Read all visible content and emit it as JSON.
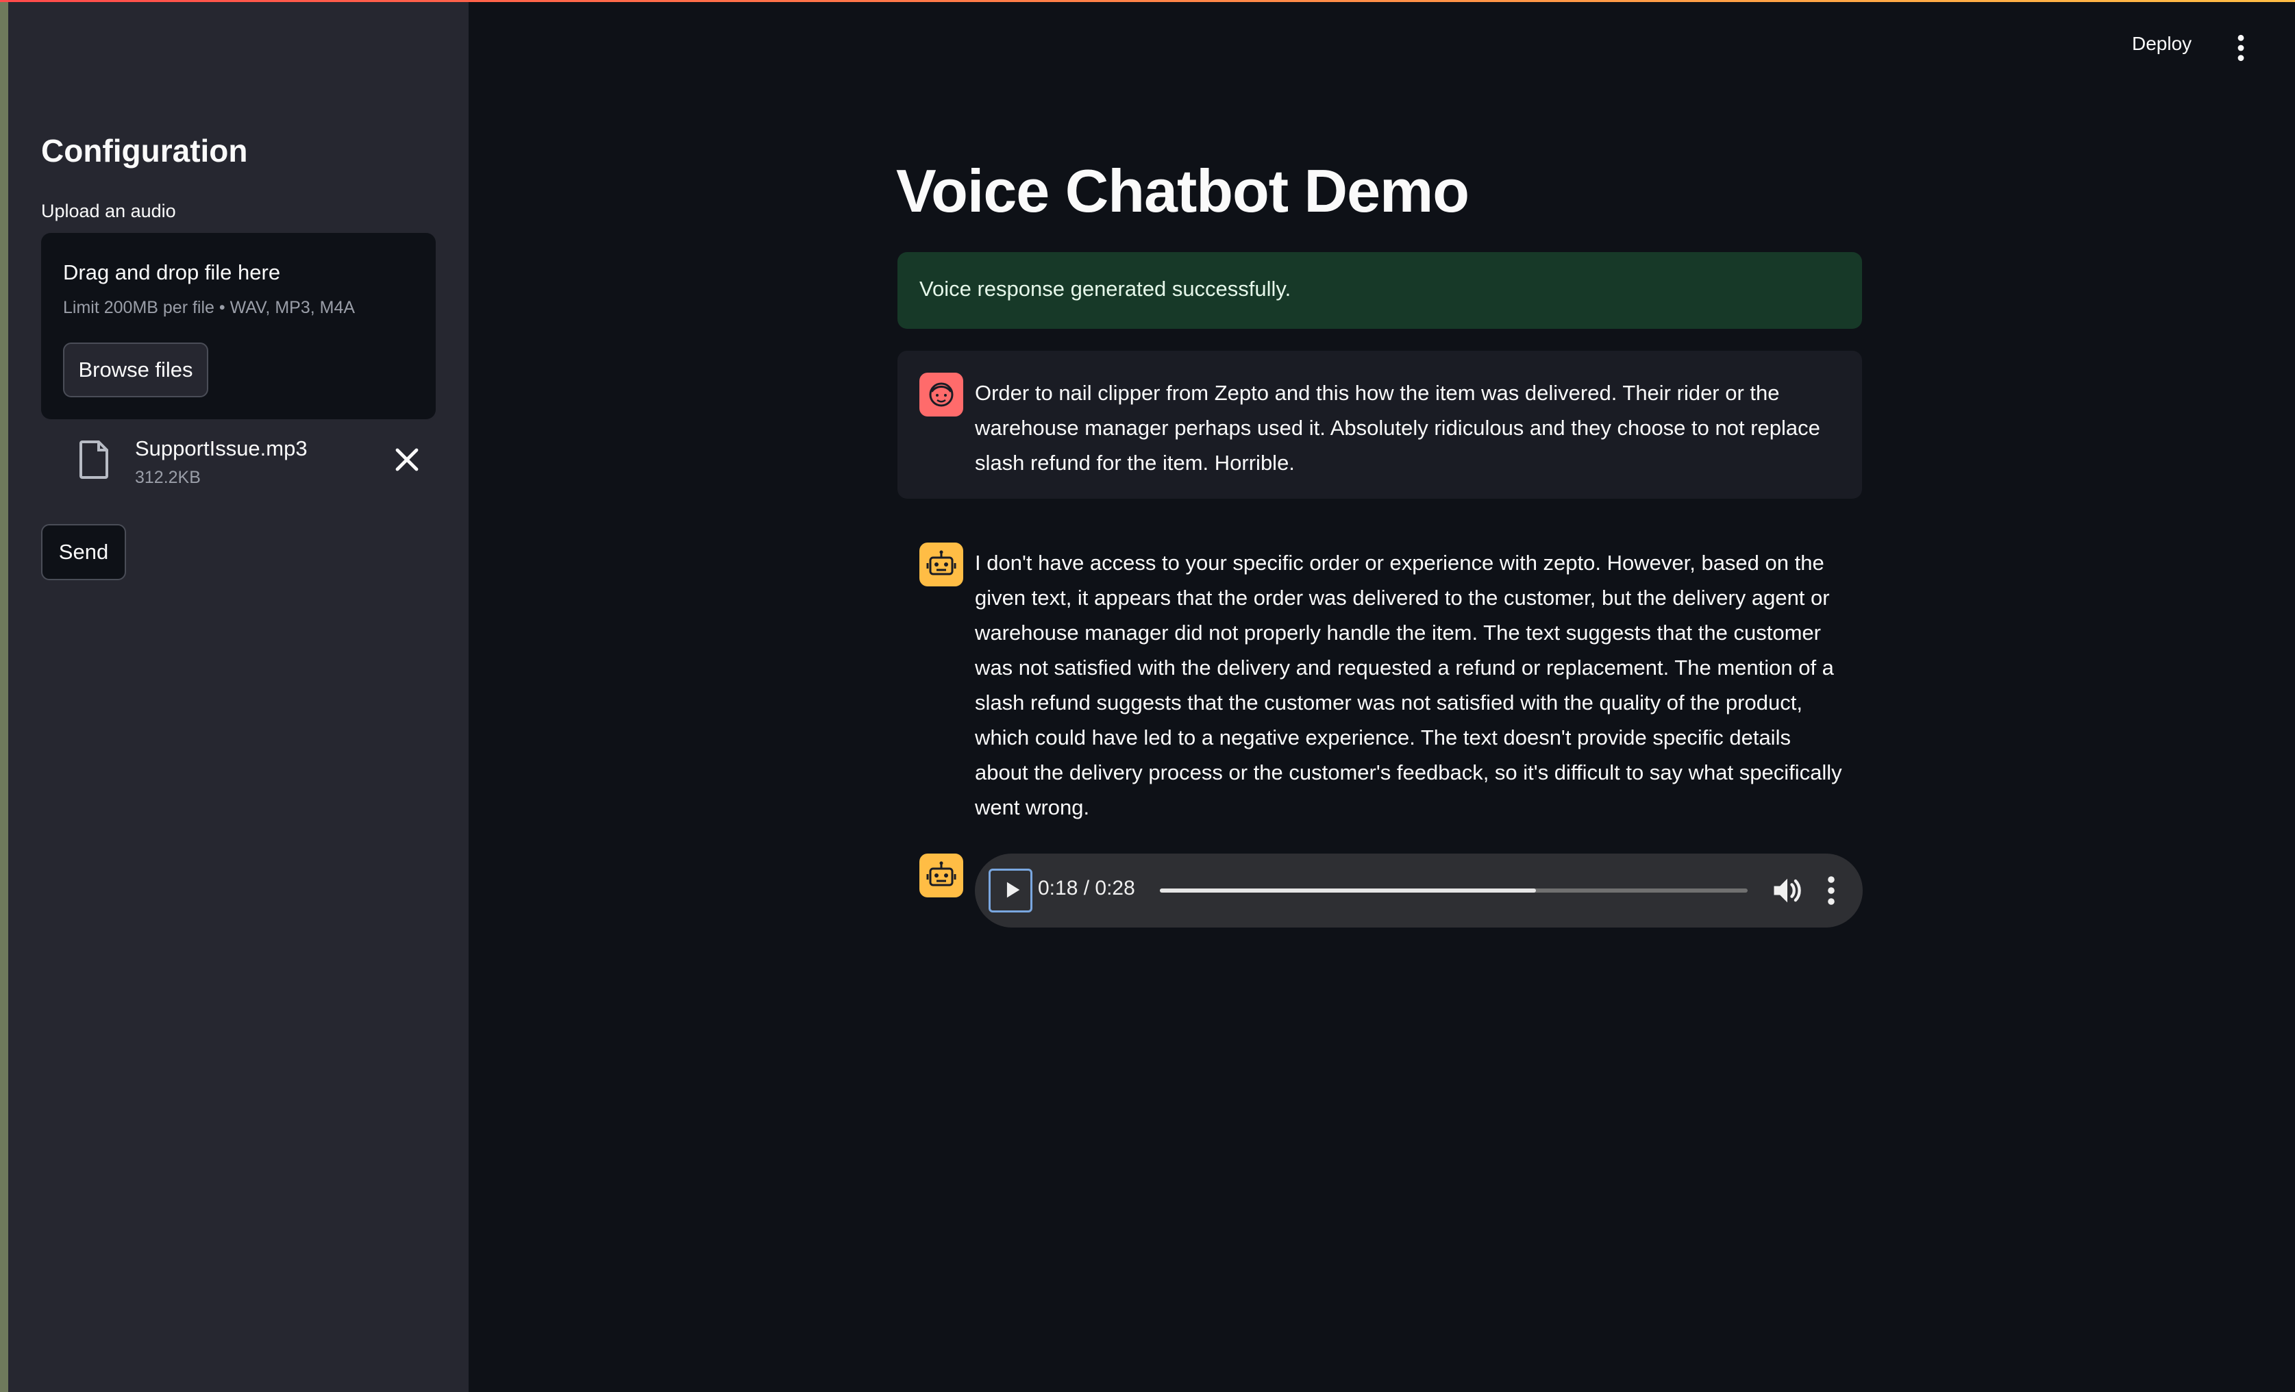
{
  "header": {
    "deploy_label": "Deploy",
    "menu_icon": "more-vertical-icon"
  },
  "sidebar": {
    "title": "Configuration",
    "uploader": {
      "label": "Upload an audio",
      "drop_title": "Drag and drop file here",
      "limit_text": "Limit 200MB per file • WAV, MP3, M4A",
      "browse_label": "Browse files"
    },
    "file": {
      "name": "SupportIssue.mp3",
      "size": "312.2KB",
      "icon": "file-icon",
      "remove_icon": "close-icon"
    },
    "send_label": "Send"
  },
  "main": {
    "title": "Voice Chatbot Demo",
    "success_message": "Voice response generated successfully.",
    "messages": [
      {
        "role": "user",
        "avatar_icon": "face-icon",
        "text": "Order to nail clipper from Zepto and this how the item was delivered. Their rider or the warehouse manager perhaps used it. Absolutely ridiculous and they choose to not replace slash refund for the item. Horrible."
      },
      {
        "role": "assistant",
        "avatar_icon": "robot-icon",
        "text": "I don't have access to your specific order or experience with zepto. However, based on the given text, it appears that the order was delivered to the customer, but the delivery agent or warehouse manager did not properly handle the item. The text suggests that the customer was not satisfied with the delivery and requested a refund or replacement. The mention of a slash refund suggests that the customer was not satisfied with the quality of the product, which could have led to a negative experience. The text doesn't provide specific details about the delivery process or the customer's feedback, so it's difficult to say what specifically went wrong."
      }
    ],
    "audio": {
      "avatar_icon": "robot-icon",
      "time_display": "0:18 / 0:28",
      "progress": 0.64,
      "play_icon": "play-icon",
      "volume_icon": "volume-icon",
      "menu_icon": "more-vertical-icon"
    }
  },
  "colors": {
    "background": "#0e1117",
    "sidebar": "#262730",
    "success_bg": "#173928",
    "user_avatar": "#ff6b6b",
    "bot_avatar": "#ffbd45"
  }
}
